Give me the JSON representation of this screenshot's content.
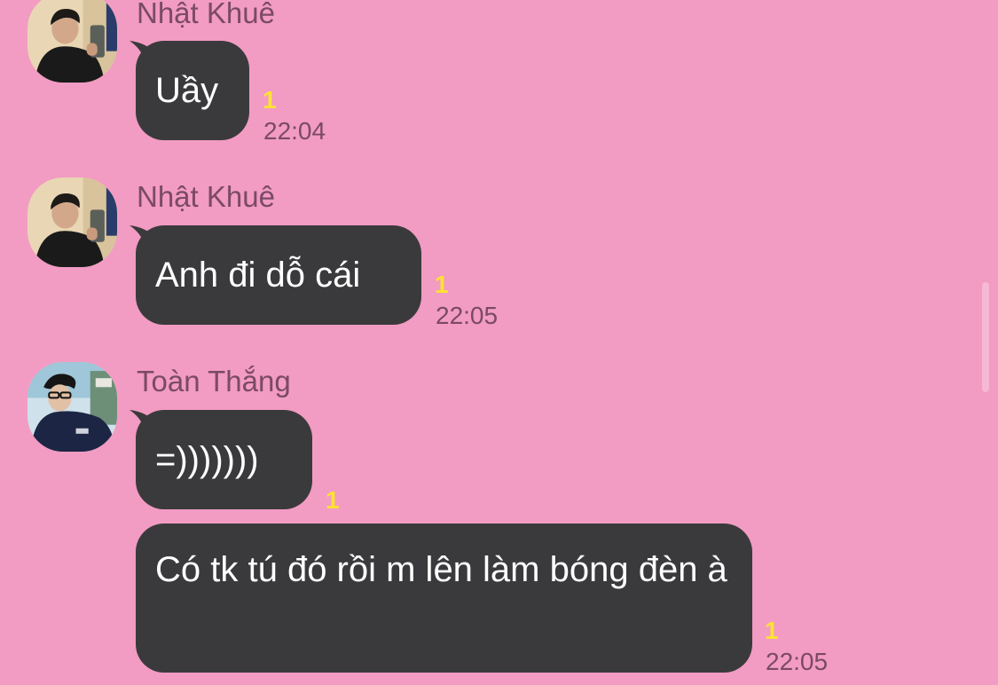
{
  "colors": {
    "background": "#f29bc3",
    "bubble": "#3a3a3c",
    "bubble_text": "#ffffff",
    "sender_text": "#7a4a66",
    "unread": "#ffe135",
    "time_text": "#7a4a66"
  },
  "messages": [
    {
      "sender": "Nhật Khuê",
      "avatar_icon": "profile-photo-icon",
      "text": "Uầy",
      "unread_count": "1",
      "time": "22:04"
    },
    {
      "sender": "Nhật Khuê",
      "avatar_icon": "profile-photo-icon",
      "text": "Anh đi dỗ cái",
      "unread_count": "1",
      "time": "22:05"
    },
    {
      "sender": "Toàn Thắng",
      "avatar_icon": "profile-photo-icon",
      "text": "=)))))))",
      "unread_count": "1",
      "time": ""
    },
    {
      "sender": "",
      "text": "Có tk tú đó rồi m lên làm bóng đèn à",
      "unread_count": "1",
      "time": "22:05"
    }
  ]
}
